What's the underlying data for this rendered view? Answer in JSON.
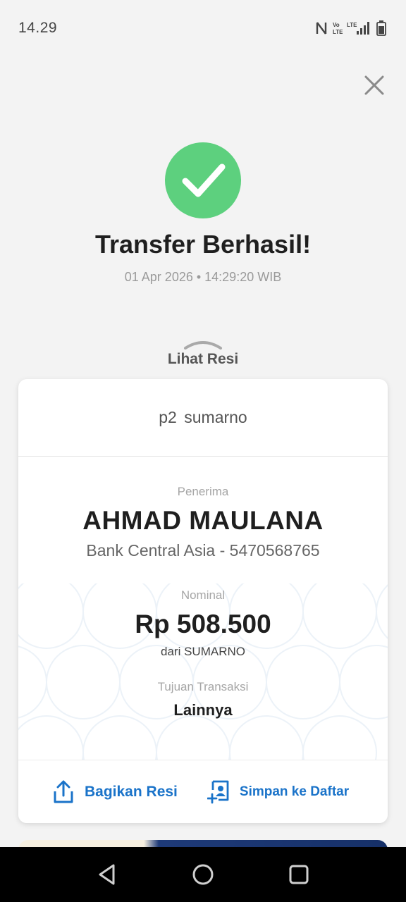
{
  "status_bar": {
    "time": "14.29",
    "icons": [
      "nfc-icon",
      "volte-icon",
      "lte-icon",
      "signal-icon",
      "battery-icon"
    ],
    "volte_label": "Vo LTE",
    "lte_label": "LTE"
  },
  "header": {
    "close_icon": "close-icon"
  },
  "success": {
    "icon": "check-icon",
    "color": "#5dd07e",
    "title": "Transfer Berhasil!",
    "datetime": "01 Apr 2026 • 14:29:20 WIB"
  },
  "receipt_toggle": {
    "icon": "chevron-up-icon",
    "label": "Lihat Resi"
  },
  "receipt": {
    "header": "p2 sumarno",
    "recipient_label": "Penerima",
    "recipient_name": "AHMAD MAULANA",
    "recipient_bank": "Bank Central Asia - 5470568765",
    "amount_label": "Nominal",
    "amount": "Rp 508.500",
    "from": "dari SUMARNO",
    "purpose_label": "Tujuan Transaksi",
    "purpose": "Lainnya"
  },
  "actions": {
    "share_label": "Bagikan Resi",
    "share_icon": "share-icon",
    "save_label": "Simpan ke Daftar",
    "save_icon": "add-contact-icon",
    "accent": "#1a73c9"
  },
  "nav": {
    "back_icon": "back-icon",
    "home_icon": "home-icon",
    "recents_icon": "recents-icon"
  }
}
